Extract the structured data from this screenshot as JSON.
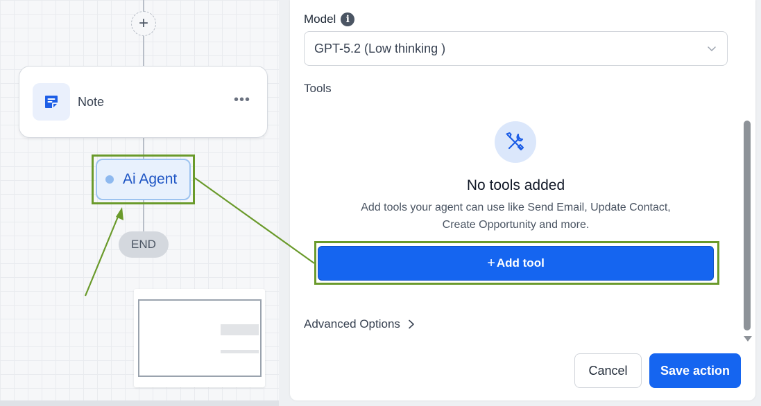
{
  "canvas": {
    "add_step_symbol": "+",
    "note_node": {
      "label": "Note",
      "menu_symbol": "•••",
      "icon": "note-icon"
    },
    "ai_agent_node": {
      "label": "Ai Agent"
    },
    "end_node": {
      "label": "END"
    }
  },
  "panel": {
    "model": {
      "label": "Model",
      "info_icon_glyph": "i",
      "selected_value": "GPT-5.2 (Low thinking )"
    },
    "tools": {
      "label": "Tools",
      "icon": "tools-icon",
      "empty_title": "No tools added",
      "empty_description": "Add tools your agent can use like Send Email, Update Contact, Create Opportunity and more.",
      "add_button_plus": "+",
      "add_button_label": "Add tool"
    },
    "advanced_options_label": "Advanced Options",
    "footer": {
      "cancel_label": "Cancel",
      "save_label": "Save action"
    }
  },
  "colors": {
    "primary": "#1565f0",
    "annotation_green": "#6a9a2b",
    "ai_agent_text": "#1e55c4"
  }
}
